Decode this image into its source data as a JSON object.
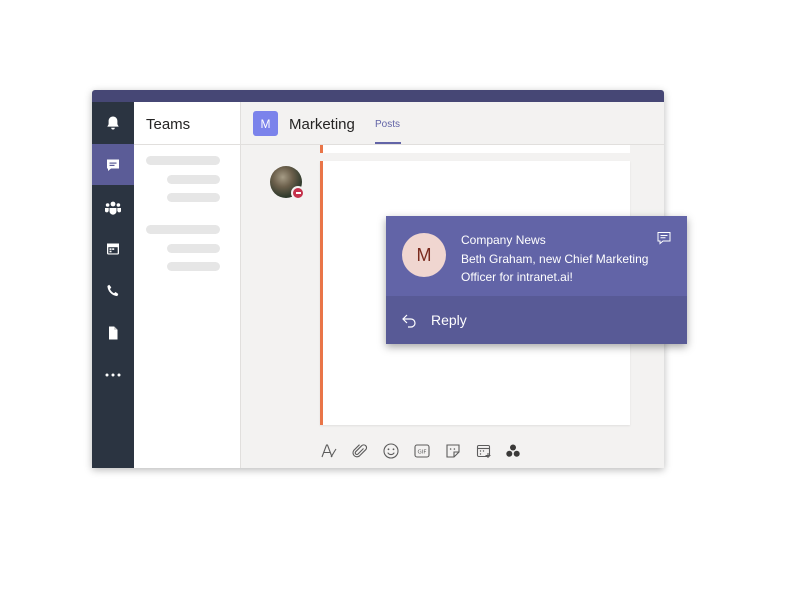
{
  "app": {
    "rail_items": [
      {
        "name": "notifications-icon"
      },
      {
        "name": "chat-icon",
        "active": true
      },
      {
        "name": "teams-icon"
      },
      {
        "name": "calendar-icon"
      },
      {
        "name": "calls-icon"
      },
      {
        "name": "files-icon"
      },
      {
        "name": "more-icon"
      }
    ]
  },
  "teams_panel": {
    "title": "Teams"
  },
  "channel": {
    "avatar_letter": "M",
    "name": "Marketing",
    "tab_posts": "Posts"
  },
  "compose_toolbar": {
    "icons": [
      "format-icon",
      "attach-icon",
      "emoji-icon",
      "gif-icon",
      "sticker-icon",
      "meeting-icon",
      "apps-icon",
      "send-icon"
    ]
  },
  "notification": {
    "avatar_letter": "M",
    "title": "Company News",
    "body": "Beth Graham, new Chief Marketing Officer for intranet.ai!",
    "reply_label": "Reply",
    "colors": {
      "top": "#6264a7",
      "bottom": "#585a96"
    }
  },
  "colors": {
    "titlebar": "#464775",
    "rail": "#2b3441",
    "rail_active": "#5b5c97",
    "accent": "#6264a7",
    "message_border": "#e97548",
    "presence": "#c4314b"
  }
}
